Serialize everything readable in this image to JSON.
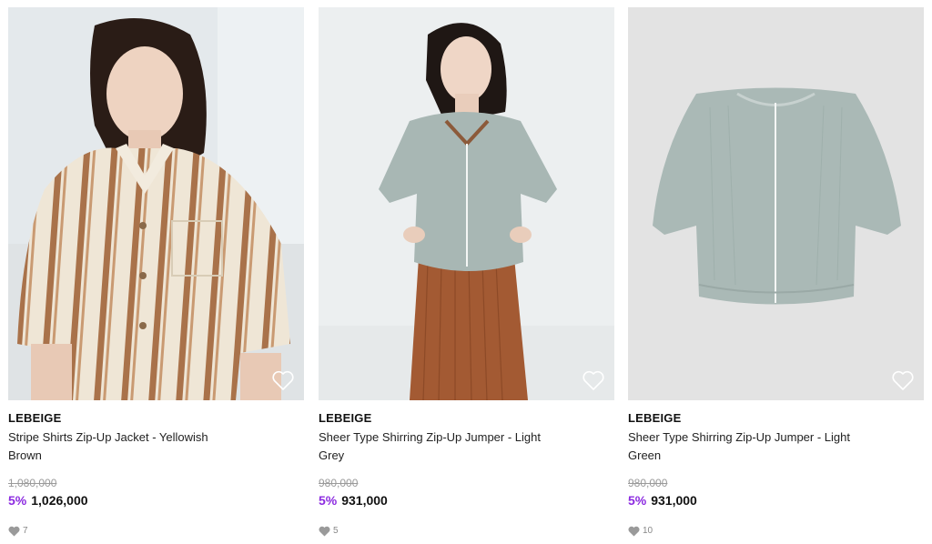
{
  "products": [
    {
      "brand": "LEBEIGE",
      "name": "Stripe Shirts Zip-Up Jacket - Yellowish Brown",
      "original_price": "1,080,000",
      "discount": "5%",
      "sale_price": "1,026,000",
      "likes": "7",
      "heart_icon": "heart-outline-icon"
    },
    {
      "brand": "LEBEIGE",
      "name": "Sheer Type Shirring Zip-Up Jumper - Light Grey",
      "original_price": "980,000",
      "discount": "5%",
      "sale_price": "931,000",
      "likes": "5",
      "heart_icon": "heart-outline-icon"
    },
    {
      "brand": "LEBEIGE",
      "name": "Sheer Type Shirring Zip-Up Jumper - Light Green",
      "original_price": "980,000",
      "discount": "5%",
      "sale_price": "931,000",
      "likes": "10",
      "heart_icon": "heart-outline-icon"
    }
  ],
  "colors": {
    "discount": "#8c2be0",
    "original_price": "#9a9a9a",
    "like_count": "#888888"
  }
}
